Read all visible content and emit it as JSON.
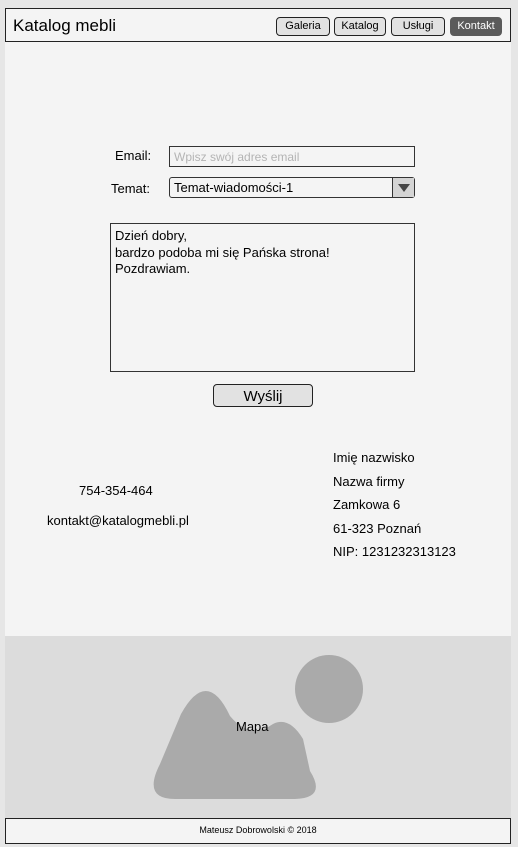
{
  "header": {
    "brand": "Katalog mebli",
    "nav": [
      "Galeria",
      "Katalog",
      "Usługi",
      "Kontakt"
    ],
    "active": "Kontakt"
  },
  "form": {
    "email_label": "Email:",
    "email_placeholder": "Wpisz swój adres email",
    "email_value": "",
    "topic_label": "Temat:",
    "topic_selected": "Temat-wiadomości-1",
    "message": "Dzień dobry,\nbardzo podoba mi się Pańska strona!\nPozdrawiam.",
    "send_label": "Wyślij"
  },
  "contact": {
    "phone": "754-354-464",
    "email": "kontakt@katalogmebli.pl"
  },
  "company": {
    "name": "Imię nazwisko",
    "firm": "Nazwa firmy",
    "street": "Zamkowa 6",
    "city": "61-323 Poznań",
    "nip": "NIP: 1231232313123"
  },
  "map": {
    "label": "Mapa",
    "icon": "image-placeholder-icon"
  },
  "footer": {
    "text": "Mateusz Dobrowolski  © 2018"
  },
  "colors": {
    "page_bg": "#f4f4f4",
    "map_bg": "#dcdcdc",
    "map_shape": "#aaaaaa",
    "active_nav": "#5b5b5b"
  }
}
